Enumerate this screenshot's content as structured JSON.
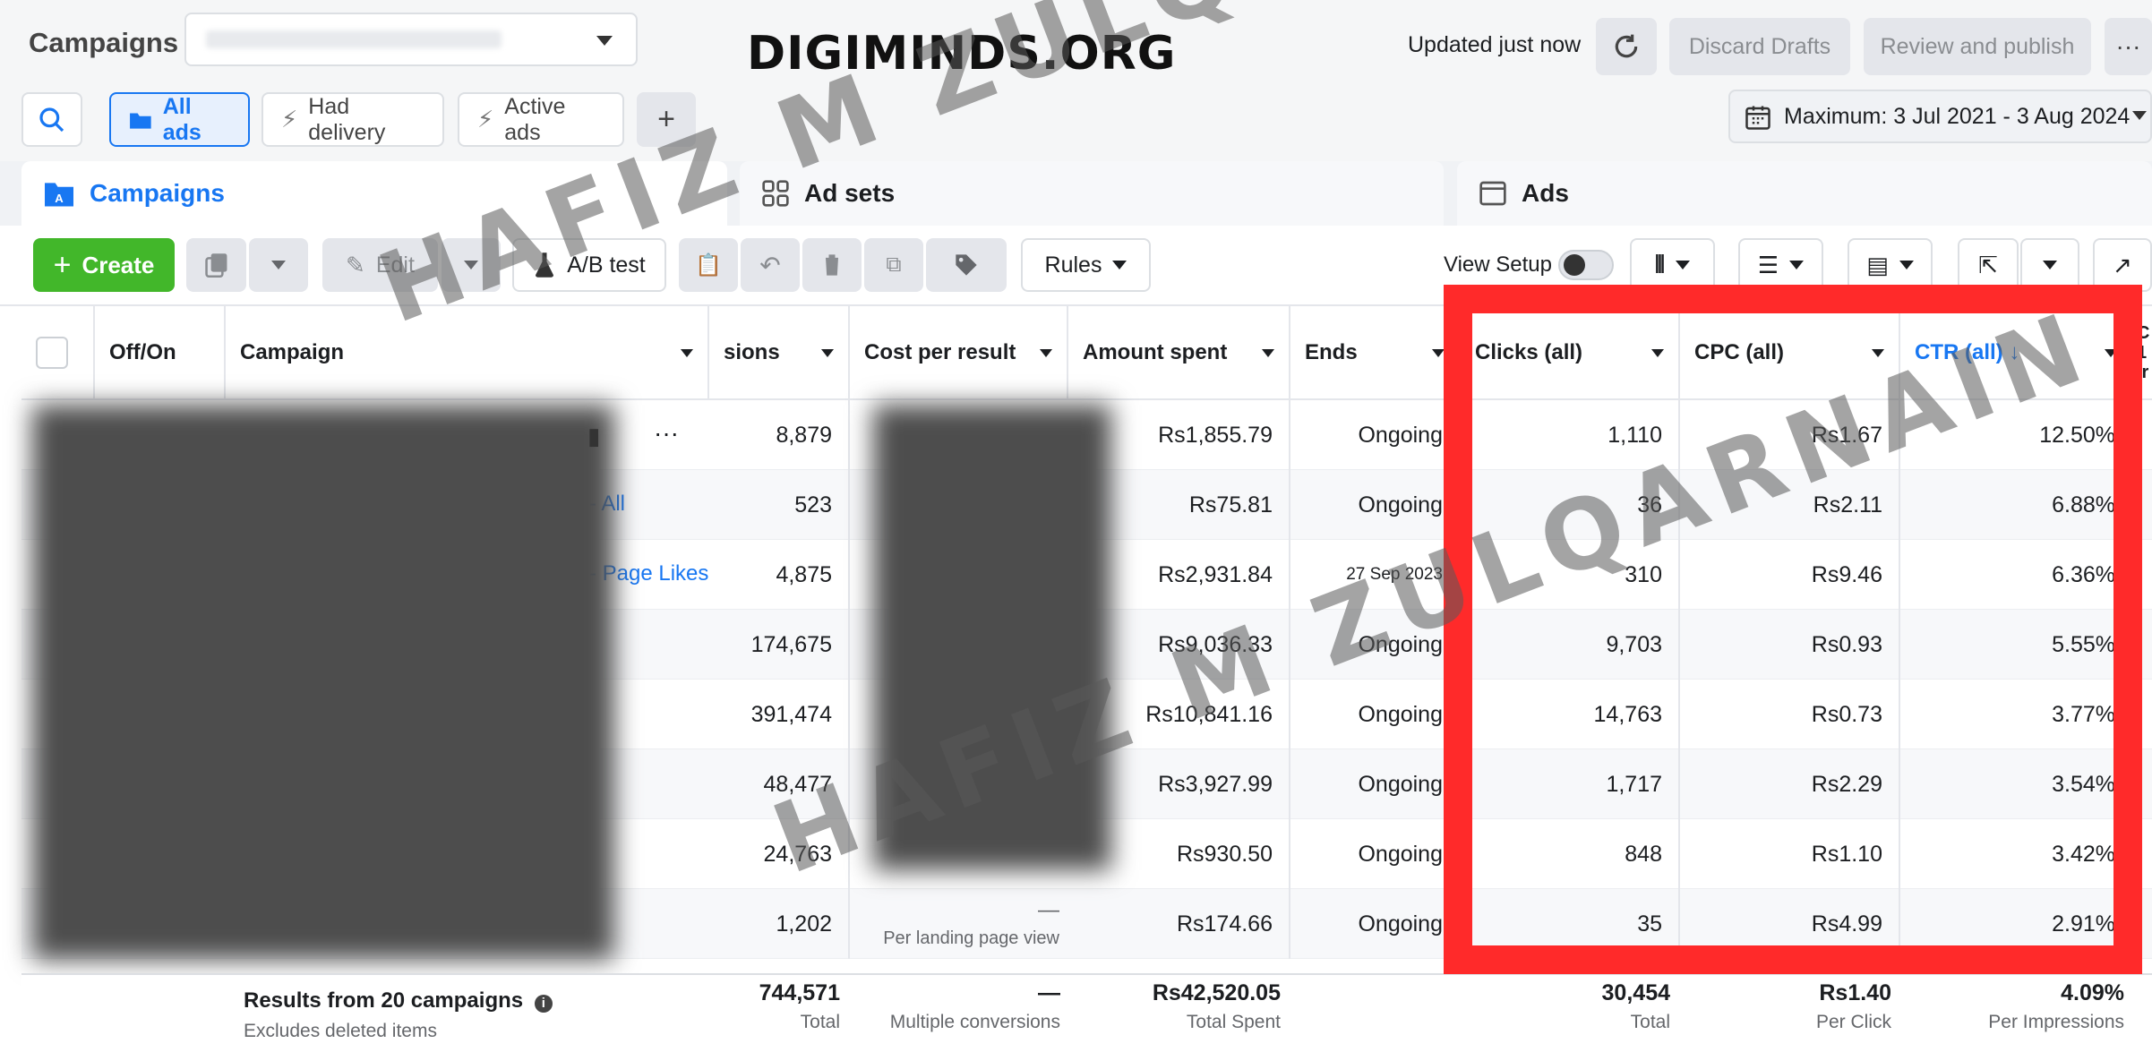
{
  "header": {
    "title": "Campaigns",
    "brand": "DIGIMINDS.ORG",
    "updated": "Updated just now",
    "discard": "Discard Drafts",
    "review": "Review and publish",
    "more": "···"
  },
  "filters": {
    "all_ads": "All ads",
    "had_delivery": "Had delivery",
    "active_ads": "Active ads",
    "add": "+",
    "date_range": "Maximum: 3 Jul 2021 - 3 Aug 2024"
  },
  "tabs": {
    "campaigns": "Campaigns",
    "ad_sets": "Ad sets",
    "ads": "Ads"
  },
  "toolbar": {
    "create": "Create",
    "edit": "Edit",
    "ab_test": "A/B test",
    "rules": "Rules",
    "view_setup": "View Setup"
  },
  "columns": {
    "off_on": "Off/On",
    "campaign": "Campaign",
    "impressions": "sions",
    "cost_per_result": "Cost per result",
    "amount_spent": "Amount spent",
    "ends": "Ends",
    "clicks": "Clicks (all)",
    "cpc": "CPC (all)",
    "ctr": "CTR (all) ↓",
    "extra": "C\n1\nir"
  },
  "rows": [
    {
      "link": "",
      "impr": "8,879",
      "spent": "Rs1,855.79",
      "ends": "Ongoing",
      "clicks": "1,110",
      "cpc": "Rs1.67",
      "ctr": "12.50%",
      "cpr": ""
    },
    {
      "link": "- All",
      "impr": "523",
      "spent": "Rs75.81",
      "ends": "Ongoing",
      "clicks": "36",
      "cpc": "Rs2.11",
      "ctr": "6.88%",
      "cpr": ""
    },
    {
      "link": "- Page Likes",
      "impr": "4,875",
      "spent": "Rs2,931.84",
      "ends": "27 Sep 2023",
      "clicks": "310",
      "cpc": "Rs9.46",
      "ctr": "6.36%",
      "cpr": ""
    },
    {
      "link": "",
      "impr": "174,675",
      "spent": "Rs9,036.33",
      "ends": "Ongoing",
      "clicks": "9,703",
      "cpc": "Rs0.93",
      "ctr": "5.55%",
      "cpr": ""
    },
    {
      "link": "",
      "impr": "391,474",
      "spent": "Rs10,841.16",
      "ends": "Ongoing",
      "clicks": "14,763",
      "cpc": "Rs0.73",
      "ctr": "3.77%",
      "cpr": ""
    },
    {
      "link": "",
      "impr": "48,477",
      "spent": "Rs3,927.99",
      "ends": "Ongoing",
      "clicks": "1,717",
      "cpc": "Rs2.29",
      "ctr": "3.54%",
      "cpr": ""
    },
    {
      "link": "",
      "impr": "24,763",
      "spent": "Rs930.50",
      "ends": "Ongoing",
      "clicks": "848",
      "cpc": "Rs1.10",
      "ctr": "3.42%",
      "cpr": ""
    },
    {
      "link": "",
      "impr": "1,202",
      "spent": "Rs174.66",
      "ends": "Ongoing",
      "clicks": "35",
      "cpc": "Rs4.99",
      "ctr": "2.91%",
      "cpr": "—",
      "cpr_sub": "Per landing page view"
    }
  ],
  "footer": {
    "results": "Results from 20 campaigns",
    "excludes": "Excludes deleted items",
    "impr": "744,571",
    "impr_sub": "Total",
    "cpr": "—",
    "cpr_sub": "Multiple conversions",
    "spent": "Rs42,520.05",
    "spent_sub": "Total Spent",
    "clicks": "30,454",
    "clicks_sub": "Total",
    "cpc": "Rs1.40",
    "cpc_sub": "Per Click",
    "ctr": "4.09%",
    "ctr_sub": "Per Impressions"
  },
  "watermark": {
    "text": "HAFIZ M ZULQARNAIN"
  },
  "colors": {
    "accent": "#1877f2",
    "create": "#42b72a",
    "highlight": "#ff2a2a"
  }
}
